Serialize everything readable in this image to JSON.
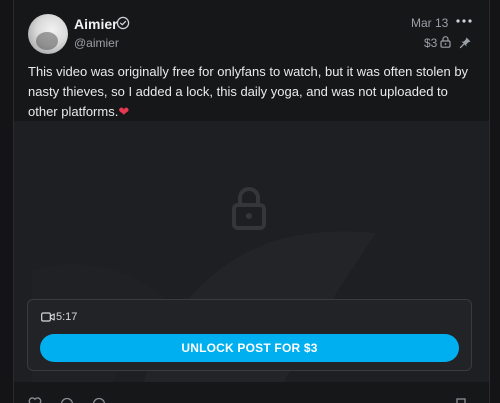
{
  "post": {
    "author_name": "Aimier",
    "author_handle": "@aimier",
    "date": "Mar 13",
    "price": "$3",
    "text_parts": [
      "This video was originally free for onlyfans to watch, but it was often stolen by nasty thieves, so I added a lock, this daily yoga, and was not uploaded to other platforms.",
      "❤"
    ]
  },
  "media": {
    "duration": "5:17",
    "unlock_label": "UNLOCK POST FOR $3"
  },
  "colors": {
    "accent": "#00aff0",
    "heart": "#e53950",
    "background": "#161719",
    "media_background": "#1e1f22"
  },
  "icons": [
    "verified-icon",
    "more-icon",
    "lock-icon",
    "pin-icon",
    "video-icon",
    "heart-icon",
    "comment-icon",
    "tip-icon",
    "bookmark-icon"
  ]
}
